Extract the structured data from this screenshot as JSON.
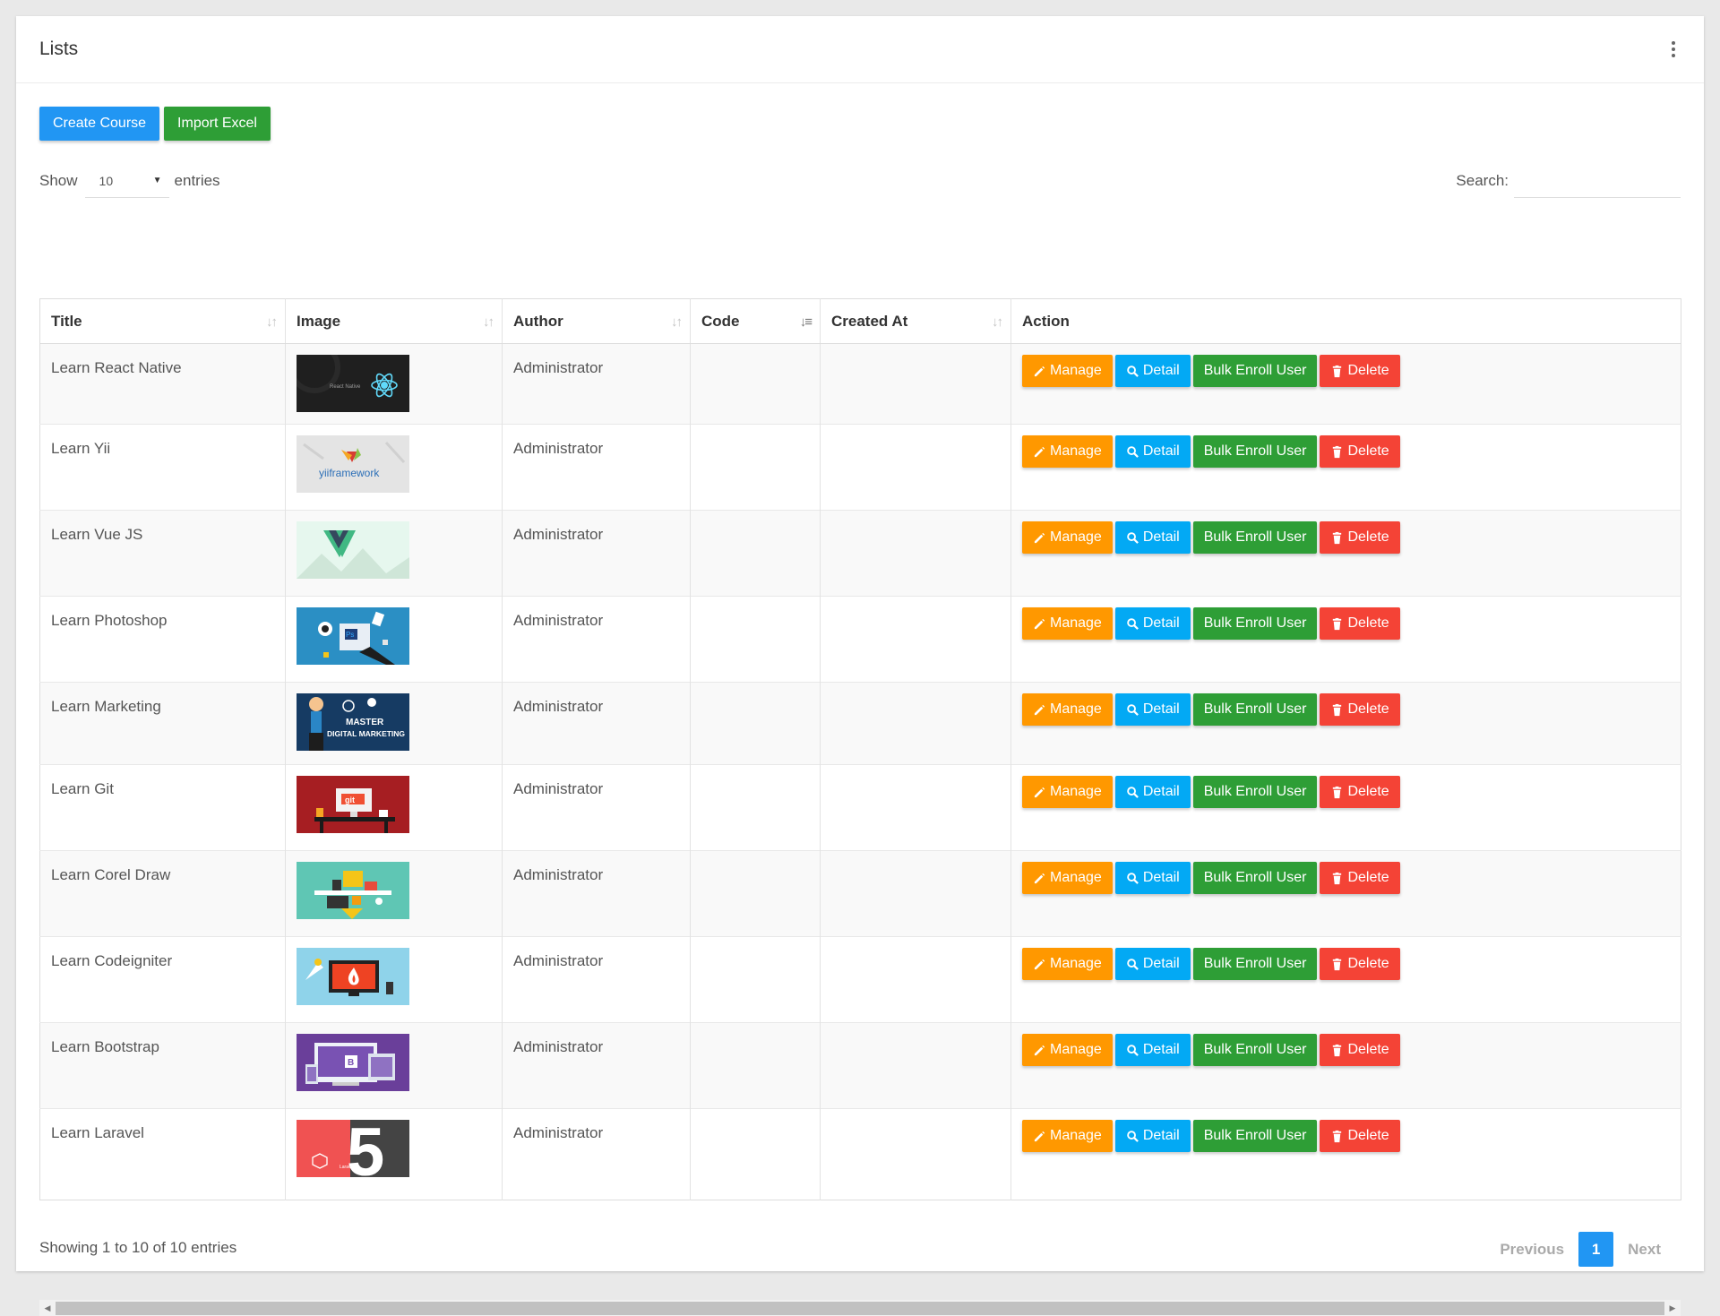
{
  "card": {
    "title": "Lists"
  },
  "toolbar": {
    "create_label": "Create Course",
    "import_label": "Import Excel"
  },
  "length": {
    "show_label": "Show",
    "selected": "10",
    "entries_label": "entries"
  },
  "search": {
    "label": "Search:",
    "value": ""
  },
  "table": {
    "headers": [
      "Title",
      "Image",
      "Author",
      "Code",
      "Created At",
      "Action"
    ],
    "sorted_column": "Code",
    "rows": [
      {
        "title": "Learn React Native",
        "image": "react-native-thumbnail",
        "author": "Administrator",
        "code": "",
        "created_at": ""
      },
      {
        "title": "Learn Yii",
        "image": "yii-framework-thumbnail",
        "author": "Administrator",
        "code": "",
        "created_at": ""
      },
      {
        "title": "Learn Vue JS",
        "image": "vue-js-thumbnail",
        "author": "Administrator",
        "code": "",
        "created_at": ""
      },
      {
        "title": "Learn Photoshop",
        "image": "photoshop-thumbnail",
        "author": "Administrator",
        "code": "",
        "created_at": ""
      },
      {
        "title": "Learn Marketing",
        "image": "digital-marketing-thumbnail",
        "author": "Administrator",
        "code": "",
        "created_at": ""
      },
      {
        "title": "Learn Git",
        "image": "git-thumbnail",
        "author": "Administrator",
        "code": "",
        "created_at": ""
      },
      {
        "title": "Learn Corel Draw",
        "image": "corel-draw-thumbnail",
        "author": "Administrator",
        "code": "",
        "created_at": ""
      },
      {
        "title": "Learn Codeigniter",
        "image": "codeigniter-thumbnail",
        "author": "Administrator",
        "code": "",
        "created_at": ""
      },
      {
        "title": "Learn Bootstrap",
        "image": "bootstrap-thumbnail",
        "author": "Administrator",
        "code": "",
        "created_at": ""
      },
      {
        "title": "Learn Laravel",
        "image": "laravel-thumbnail",
        "author": "Administrator",
        "code": "",
        "created_at": ""
      }
    ]
  },
  "actions": {
    "manage_label": "Manage",
    "detail_label": "Detail",
    "bulk_label": "Bulk Enroll User",
    "delete_label": "Delete"
  },
  "thumb_text": {
    "react": "React Native",
    "yii": "yiiframework",
    "marketing_1": "MASTER",
    "marketing_2": "DIGITAL MARKETING",
    "git": "git",
    "ps": "Ps",
    "bootstrap": "B",
    "laravel": "Laravel",
    "laravel_num": "5"
  },
  "footer": {
    "info": "Showing 1 to 10 of 10 entries"
  },
  "pagination": {
    "previous": "Previous",
    "current": "1",
    "next": "Next"
  },
  "colors": {
    "primary": "#2196f3",
    "success": "#2e9e36",
    "warning": "#ff9800",
    "info": "#03a9f4",
    "danger": "#f44336"
  }
}
